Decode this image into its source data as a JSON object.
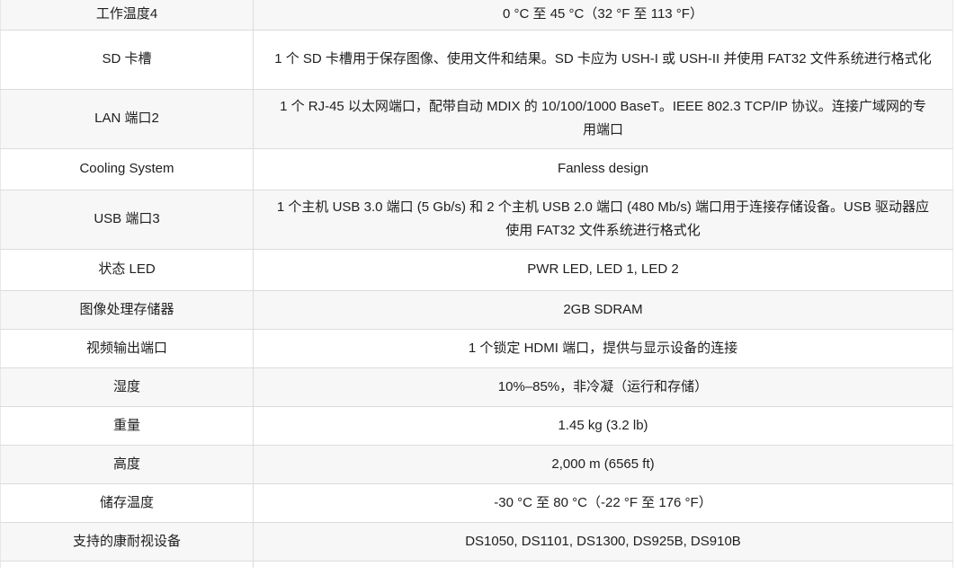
{
  "table": {
    "column_count": 2,
    "colors": {
      "row_shaded_bg": "#f7f7f7",
      "row_plain_bg": "#ffffff",
      "border": "#dcdcdc",
      "text": "#202020"
    },
    "rows": [
      {
        "label": "工作温度4",
        "value": "0 °C 至 45 °C（32 °F 至 113 °F）",
        "shaded": true,
        "lines": 1,
        "clipped_top": true
      },
      {
        "label": "SD 卡槽",
        "value": "1 个 SD 卡槽用于保存图像、使用文件和结果。SD 卡应为 USH-I 或 USH-II 并使用 FAT32 文件系统进行格式化",
        "shaded": false,
        "lines": 2
      },
      {
        "label": "LAN 端口2",
        "value": "1 个 RJ-45 以太网端口，配带自动 MDIX 的 10/100/1000 BaseT。IEEE 802.3 TCP/IP 协议。连接广域网的专用端口",
        "shaded": true,
        "lines": 2
      },
      {
        "label": "Cooling System",
        "value": "Fanless design",
        "shaded": false,
        "lines": 1
      },
      {
        "label": "USB 端口3",
        "value": "1 个主机 USB 3.0 端口 (5 Gb/s) 和 2 个主机 USB 2.0 端口 (480 Mb/s) 端口用于连接存储设备。USB 驱动器应使用 FAT32 文件系统进行格式化",
        "shaded": true,
        "lines": 2
      },
      {
        "label": "状态 LED",
        "value": "PWR LED, LED 1, LED 2",
        "shaded": false,
        "lines": 1
      },
      {
        "label": "图像处理存储器",
        "value": "2GB SDRAM",
        "shaded": true,
        "lines": 1
      },
      {
        "label": "视频输出端口",
        "value": "1 个锁定 HDMI 端口，提供与显示设备的连接",
        "shaded": false,
        "lines": 1
      },
      {
        "label": "湿度",
        "value": "10%–85%，非冷凝（运行和存储）",
        "shaded": true,
        "lines": 1
      },
      {
        "label": "重量",
        "value": "1.45 kg (3.2 lb)",
        "shaded": false,
        "lines": 1
      },
      {
        "label": "高度",
        "value": "2,000 m (6565 ft)",
        "shaded": true,
        "lines": 1
      },
      {
        "label": "储存温度",
        "value": "-30 °C 至 80 °C（-22 °F 至 176 °F）",
        "shaded": false,
        "lines": 1
      },
      {
        "label": "支持的康耐视设备",
        "value": "DS1050, DS1101, DS1300, DS925B, DS910B",
        "shaded": true,
        "lines": 1
      },
      {
        "label": "",
        "value": "",
        "shaded": false,
        "lines": 1,
        "clipped_bottom": true
      }
    ]
  }
}
